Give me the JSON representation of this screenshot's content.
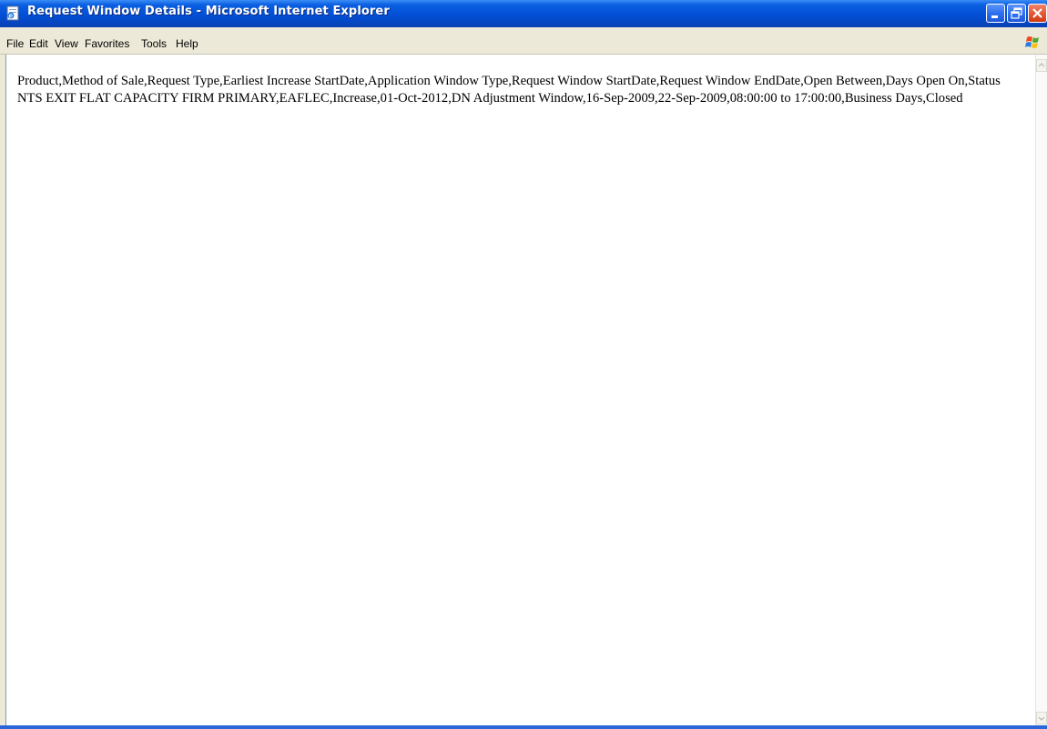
{
  "window": {
    "title": "Request Window Details - Microsoft Internet Explorer"
  },
  "menu": {
    "file": "File",
    "edit": "Edit",
    "view": "View",
    "favorites": "Favorites",
    "tools": "Tools",
    "help": "Help"
  },
  "document": {
    "lines": [
      "Product,Method of Sale,Request Type,Earliest Increase StartDate,Application Window Type,Request Window StartDate,Request Window EndDate,Open Between,Days Open On,Status",
      "NTS EXIT FLAT CAPACITY FIRM PRIMARY,EAFLEC,Increase,01-Oct-2012,DN Adjustment Window,16-Sep-2009,22-Sep-2009,08:00:00 to 17:00:00,Business Days,Closed"
    ]
  },
  "icons": {
    "app": "ie-page-icon",
    "minimize": "minimize-icon",
    "maximize": "restore-icon",
    "close": "close-icon",
    "brand": "windows-flag-icon"
  },
  "colors": {
    "titlebar": "#0351d8",
    "menubar": "#ece9d8",
    "close_button": "#e45a36"
  }
}
